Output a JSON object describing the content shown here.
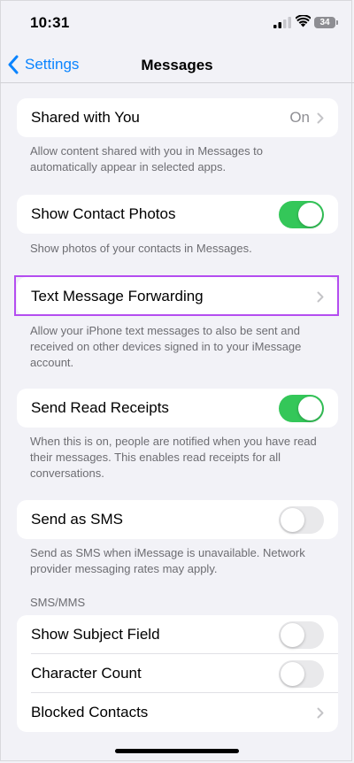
{
  "status_bar": {
    "time": "10:31",
    "battery_level": "34",
    "icons": [
      "signal-icon",
      "wifi-icon",
      "battery-icon"
    ]
  },
  "nav": {
    "back_label": "Settings",
    "title": "Messages"
  },
  "shared_with_you": {
    "label": "Shared with You",
    "value": "On",
    "footer": "Allow content shared with you in Messages to automatically appear in selected apps."
  },
  "contact_photos": {
    "label": "Show Contact Photos",
    "enabled": true,
    "footer": "Show photos of your contacts in Messages."
  },
  "text_forwarding": {
    "label": "Text Message Forwarding",
    "footer": "Allow your iPhone text messages to also be sent and received on other devices signed in to your iMessage account.",
    "highlight_color": "#b44df0"
  },
  "read_receipts": {
    "label": "Send Read Receipts",
    "enabled": true,
    "footer": "When this is on, people are notified when you have read their messages. This enables read receipts for all conversations."
  },
  "send_sms": {
    "label": "Send as SMS",
    "enabled": false,
    "footer": "Send as SMS when iMessage is unavailable. Network provider messaging rates may apply."
  },
  "sms_mms": {
    "header": "SMS/MMS",
    "subject_field": {
      "label": "Show Subject Field",
      "enabled": false
    },
    "character_count": {
      "label": "Character Count",
      "enabled": false
    },
    "blocked_contacts": {
      "label": "Blocked Contacts"
    }
  },
  "colors": {
    "accent": "#0a84ff",
    "toggle_on": "#34c759",
    "toggle_off": "#e9e9eb",
    "background": "#f2f2f7"
  }
}
